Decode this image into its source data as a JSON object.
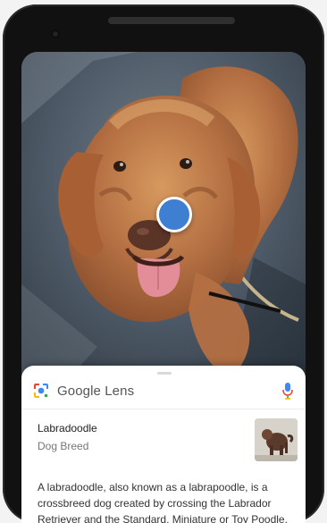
{
  "lens": {
    "title": "Google Lens",
    "logo_icon": "google-lens-icon",
    "mic_icon": "microphone-icon"
  },
  "result": {
    "title": "Labradoodle",
    "subtitle": "Dog Breed",
    "thumbnail": "labradoodle-thumbnail",
    "description": "A labradoodle, also known as a labrapoodle, is a crossbreed dog created by crossing the Labrador Retriever and the Standard, Miniature or Toy Poodle."
  },
  "colors": {
    "focus_dot": "#3f7fd1",
    "mic_blue": "#4285f4",
    "dog_fur": "#b77649"
  }
}
